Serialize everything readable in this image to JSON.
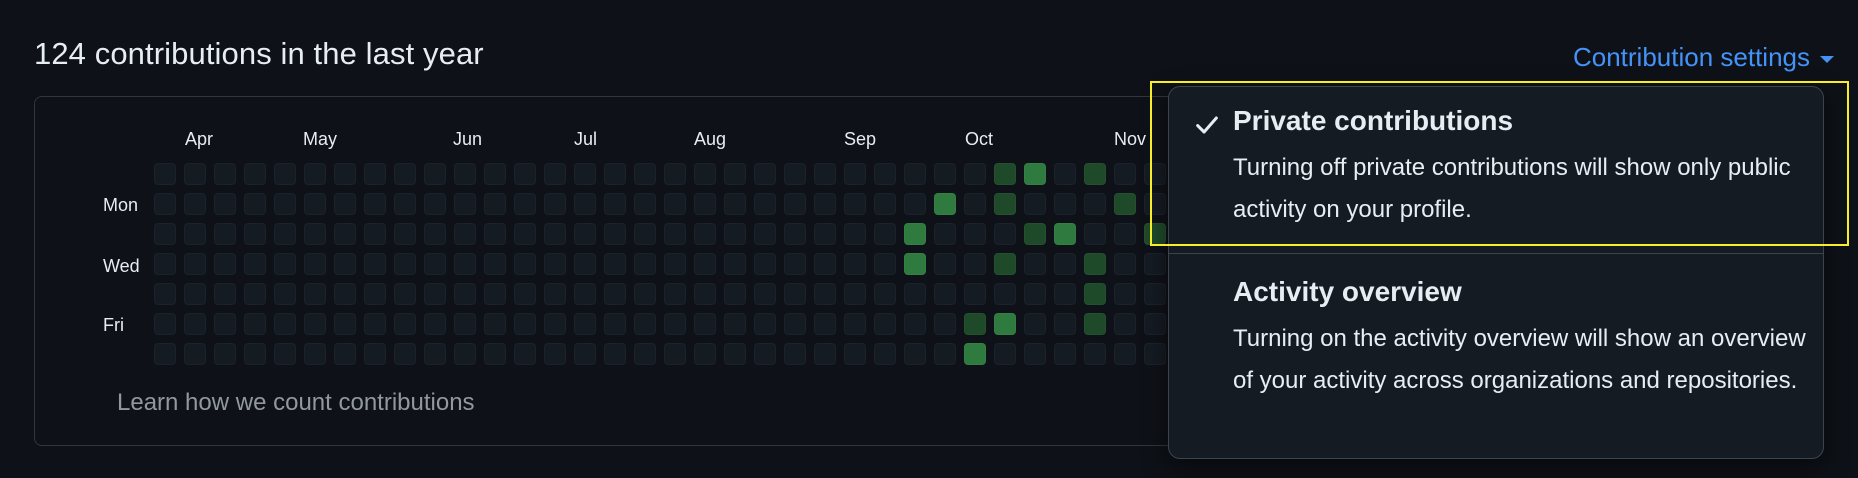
{
  "header": {
    "contributions_text": "124 contributions in the last year",
    "settings_label": "Contribution settings"
  },
  "graph": {
    "months": [
      "Apr",
      "May",
      "Jun",
      "Jul",
      "Aug",
      "Sep",
      "Oct",
      "Nov"
    ],
    "day_labels": [
      "Mon",
      "Wed",
      "Fri"
    ],
    "weeks": [
      [
        0,
        0,
        0,
        0,
        0,
        0,
        0
      ],
      [
        0,
        0,
        0,
        0,
        0,
        0,
        0
      ],
      [
        0,
        0,
        0,
        0,
        0,
        0,
        0
      ],
      [
        0,
        0,
        0,
        0,
        0,
        0,
        0
      ],
      [
        0,
        0,
        0,
        0,
        0,
        0,
        0
      ],
      [
        0,
        0,
        0,
        0,
        0,
        0,
        0
      ],
      [
        0,
        0,
        0,
        0,
        0,
        0,
        0
      ],
      [
        0,
        0,
        0,
        0,
        0,
        0,
        0
      ],
      [
        0,
        0,
        0,
        0,
        0,
        0,
        0
      ],
      [
        0,
        0,
        0,
        0,
        0,
        0,
        0
      ],
      [
        0,
        0,
        0,
        0,
        0,
        0,
        0
      ],
      [
        0,
        0,
        0,
        0,
        0,
        0,
        0
      ],
      [
        0,
        0,
        0,
        0,
        0,
        0,
        0
      ],
      [
        0,
        0,
        0,
        0,
        0,
        0,
        0
      ],
      [
        0,
        0,
        0,
        0,
        0,
        0,
        0
      ],
      [
        0,
        0,
        0,
        0,
        0,
        0,
        0
      ],
      [
        0,
        0,
        0,
        0,
        0,
        0,
        0
      ],
      [
        0,
        0,
        0,
        0,
        0,
        0,
        0
      ],
      [
        0,
        0,
        0,
        0,
        0,
        0,
        0
      ],
      [
        0,
        0,
        0,
        0,
        0,
        0,
        0
      ],
      [
        0,
        0,
        0,
        0,
        0,
        0,
        0
      ],
      [
        0,
        0,
        0,
        0,
        0,
        0,
        0
      ],
      [
        0,
        0,
        0,
        0,
        0,
        0,
        0
      ],
      [
        0,
        0,
        0,
        0,
        0,
        0,
        0
      ],
      [
        0,
        0,
        0,
        0,
        0,
        0,
        0
      ],
      [
        0,
        0,
        2,
        2,
        0,
        0,
        0
      ],
      [
        0,
        2,
        0,
        0,
        0,
        0,
        0
      ],
      [
        0,
        0,
        0,
        0,
        0,
        1,
        2
      ],
      [
        1,
        1,
        0,
        1,
        0,
        2,
        0
      ],
      [
        2,
        0,
        1,
        0,
        0,
        0,
        0
      ],
      [
        0,
        0,
        2,
        0,
        0,
        0,
        0
      ],
      [
        1,
        0,
        0,
        1,
        1,
        1,
        0
      ],
      [
        0,
        1,
        0,
        0,
        0,
        0,
        0
      ],
      [
        0,
        0,
        1,
        0,
        0,
        0,
        0
      ]
    ],
    "level_colors": [
      "#151b23",
      "#1f4a2a",
      "#2f7a3f",
      "#3ea84e"
    ],
    "learn_link": "Learn how we count contributions"
  },
  "dropdown": {
    "items": [
      {
        "title": "Private contributions",
        "description": "Turning off private contributions will show only public activity on your profile.",
        "checked": true
      },
      {
        "title": "Activity overview",
        "description": "Turning on the activity overview will show an overview of your activity across organizations and repositories.",
        "checked": false
      }
    ]
  },
  "colors": {
    "background": "#0e1117",
    "link": "#4493f8",
    "highlight": "#f7ee2a"
  },
  "icons": {
    "check": "check-icon",
    "caret": "caret-down-icon"
  }
}
